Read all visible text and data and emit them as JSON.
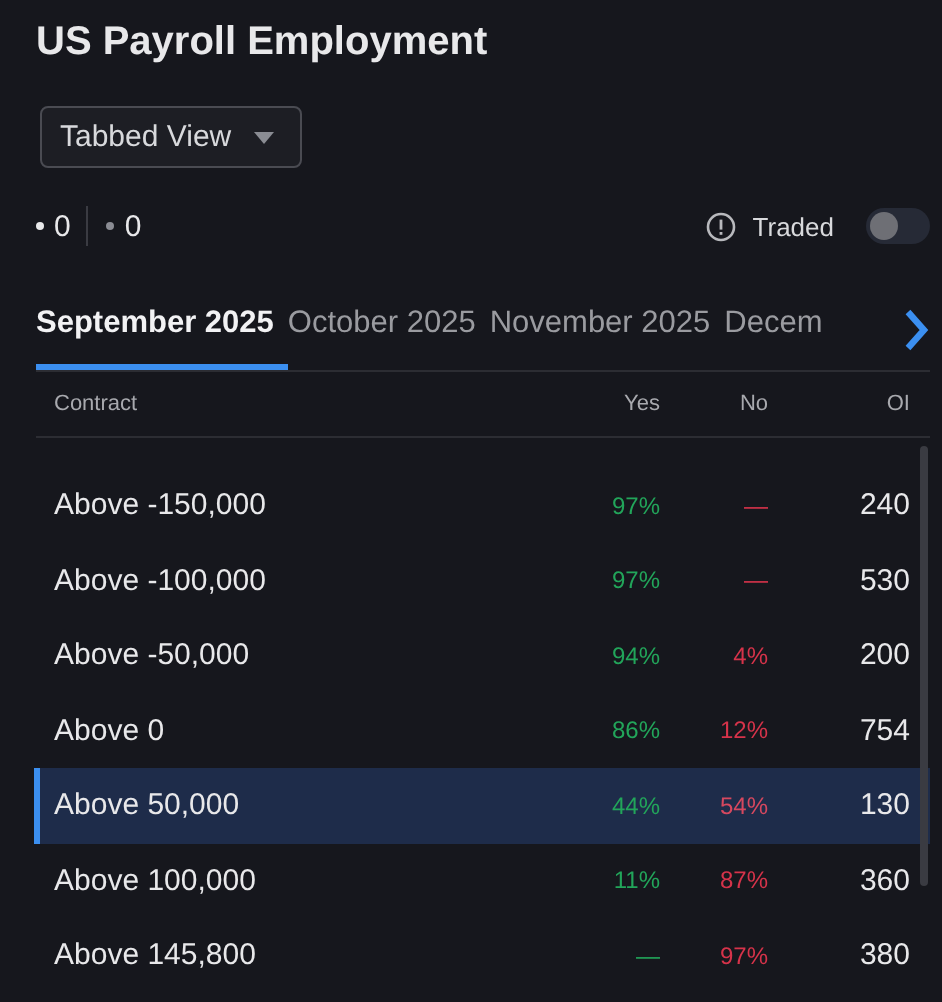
{
  "title": "US Payroll Employment",
  "view_dropdown": {
    "value": "Tabbed View"
  },
  "counts": [
    "0",
    "0"
  ],
  "traded_toggle": {
    "label": "Traded",
    "on": false
  },
  "tabs": [
    {
      "label": "September 2025",
      "selected": true
    },
    {
      "label": "October 2025",
      "selected": false
    },
    {
      "label": "November 2025",
      "selected": false
    },
    {
      "label": "Decem",
      "selected": false
    }
  ],
  "table": {
    "columns": [
      "Contract",
      "Yes",
      "No",
      "OI"
    ],
    "rows": [
      {
        "contract": "Above -150,000",
        "yes": "97%",
        "no": "—",
        "oi": "240",
        "selected": false
      },
      {
        "contract": "Above -100,000",
        "yes": "97%",
        "no": "—",
        "oi": "530",
        "selected": false
      },
      {
        "contract": "Above -50,000",
        "yes": "94%",
        "no": "4%",
        "oi": "200",
        "selected": false
      },
      {
        "contract": "Above 0",
        "yes": "86%",
        "no": "12%",
        "oi": "754",
        "selected": false
      },
      {
        "contract": "Above 50,000",
        "yes": "44%",
        "no": "54%",
        "oi": "130",
        "selected": true
      },
      {
        "contract": "Above 100,000",
        "yes": "11%",
        "no": "87%",
        "oi": "360",
        "selected": false
      },
      {
        "contract": "Above 145,800",
        "yes": "—",
        "no": "97%",
        "oi": "380",
        "selected": false
      }
    ]
  }
}
